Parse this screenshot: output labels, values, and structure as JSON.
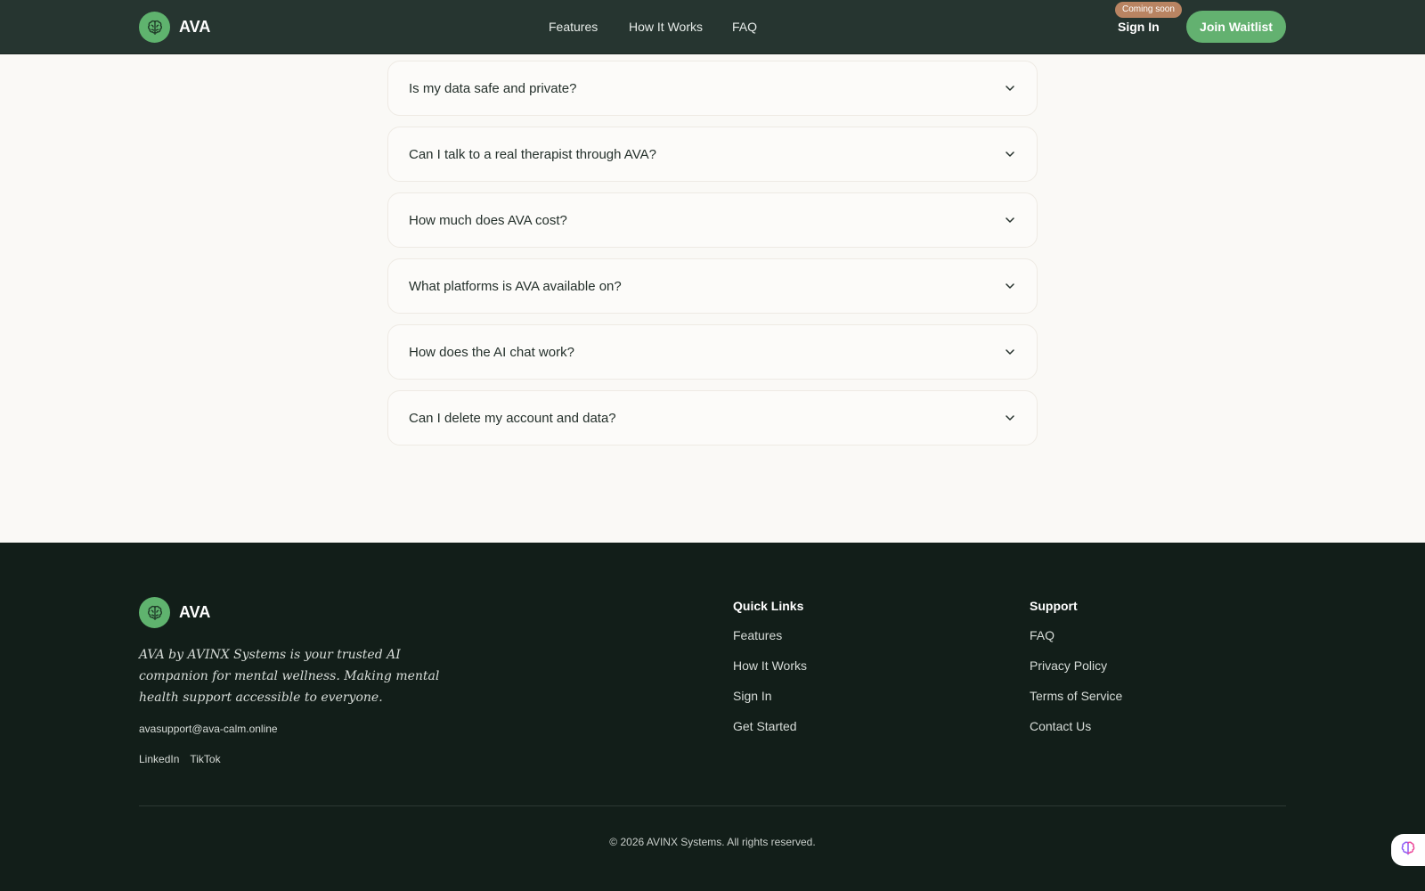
{
  "header": {
    "brand": "AVA",
    "nav": [
      "Features",
      "How It Works",
      "FAQ"
    ],
    "badge": "Coming soon",
    "signin": "Sign In",
    "cta": "Join Waitlist"
  },
  "faq": {
    "items": [
      "Is my data safe and private?",
      "Can I talk to a real therapist through AVA?",
      "How much does AVA cost?",
      "What platforms is AVA available on?",
      "How does the AI chat work?",
      "Can I delete my account and data?"
    ]
  },
  "footer": {
    "brand": "AVA",
    "tagline": "AVA by AVINX Systems is your trusted AI companion for mental wellness. Making mental health support accessible to everyone.",
    "email": "avasupport@ava-calm.online",
    "social": [
      "LinkedIn",
      "TikTok"
    ],
    "quick_links": {
      "title": "Quick Links",
      "items": [
        "Features",
        "How It Works",
        "Sign In",
        "Get Started"
      ]
    },
    "support": {
      "title": "Support",
      "items": [
        "FAQ",
        "Privacy Policy",
        "Terms of Service",
        "Contact Us"
      ]
    },
    "copyright": "© 2026 AVINX Systems. All rights reserved."
  },
  "colors": {
    "header_bg": "#263530",
    "accent_green": "#63b170",
    "badge": "#b98462",
    "footer_bg": "#121e19",
    "page_bg": "#faf9f6"
  },
  "icons": {
    "logo": "brain-icon",
    "faq_toggle": "chevron-down-icon",
    "chat_fab": "brain-icon"
  }
}
